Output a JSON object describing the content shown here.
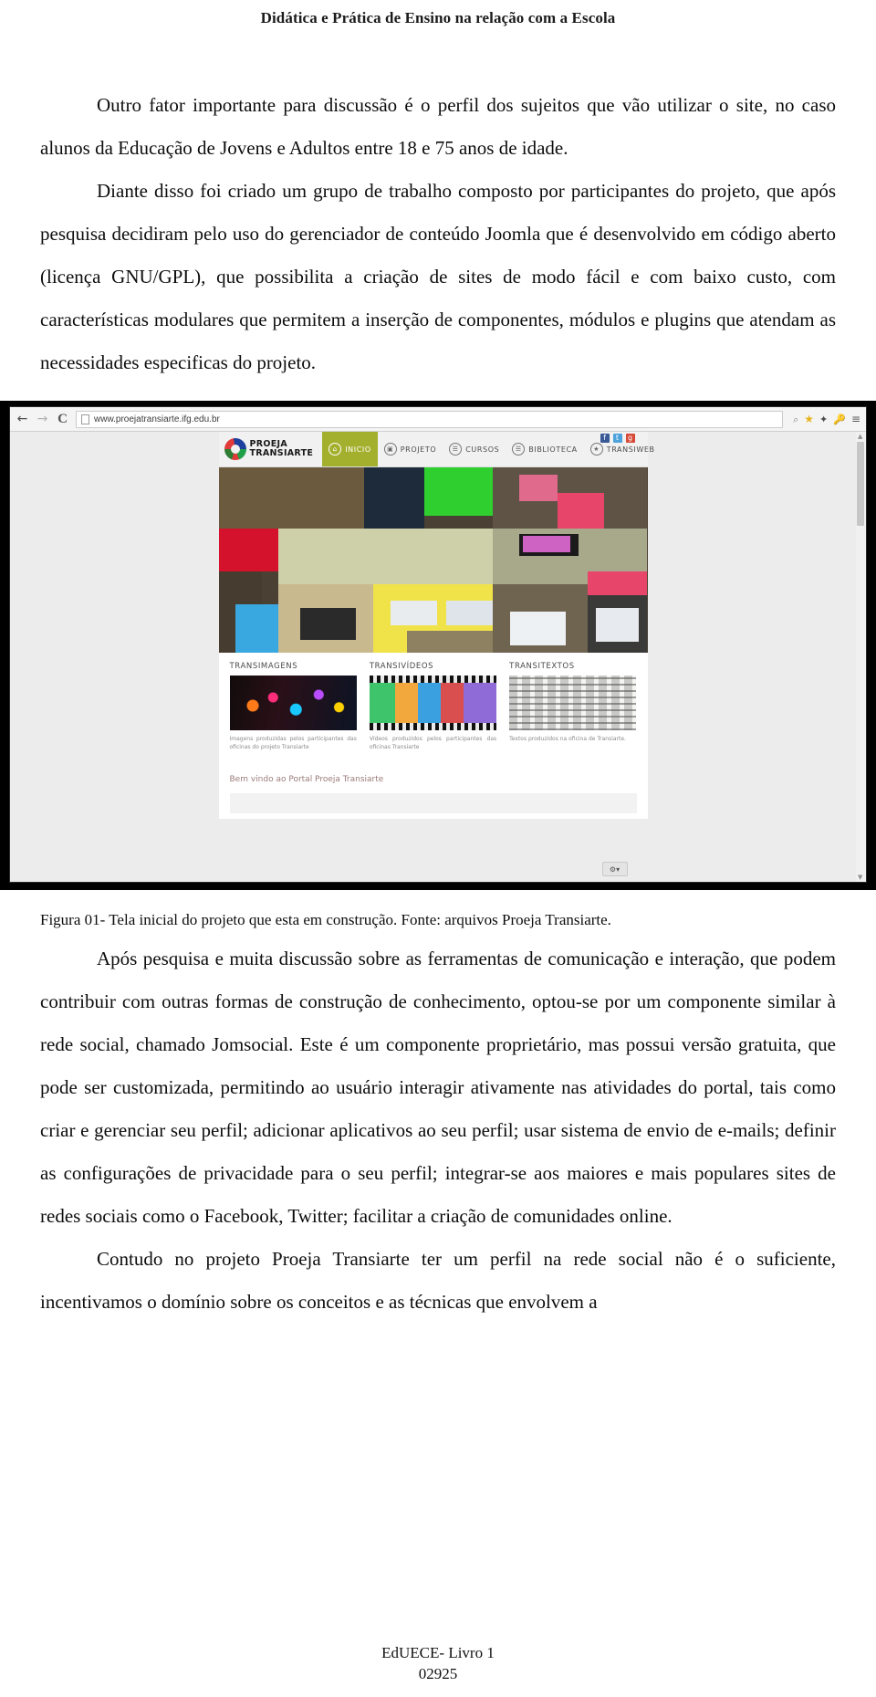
{
  "header": {
    "running_title": "Didática e Prática de Ensino na relação com a Escola"
  },
  "body": {
    "paragraph_1": "Outro fator importante para discussão é o perfil dos sujeitos que vão utilizar o site, no caso alunos da Educação de Jovens e Adultos entre 18 e 75 anos de idade.",
    "paragraph_2": "Diante disso foi criado um grupo de trabalho composto por participantes do projeto, que após pesquisa decidiram pelo uso do gerenciador de conteúdo Joomla que é desenvolvido em código aberto (licença GNU/GPL), que possibilita a criação de sites de modo fácil e com baixo custo, com características modulares que permitem a inserção de componentes, módulos e plugins que atendam as necessidades especificas do projeto.",
    "paragraph_3": "Após pesquisa e muita discussão sobre as ferramentas de comunicação e interação, que podem contribuir com outras formas de construção de conhecimento, optou-se por um componente similar à rede social, chamado Jomsocial. Este é um componente proprietário, mas possui versão gratuita, que pode ser customizada, permitindo ao usuário interagir ativamente nas atividades do portal, tais como criar e gerenciar seu perfil; adicionar aplicativos ao seu perfil; usar sistema de envio de e-mails; definir as configurações de privacidade para o seu perfil; integrar-se aos maiores e mais populares sites de redes sociais como o Facebook, Twitter; facilitar a criação de comunidades online.",
    "paragraph_4": "Contudo no projeto Proeja Transiarte ter um perfil na rede social não é o suficiente, incentivamos o domínio sobre os conceitos e as técnicas que envolvem a"
  },
  "figure": {
    "caption": "Figura 01- Tela inicial do projeto que esta em construção. Fonte: arquivos Proeja Transiarte."
  },
  "browser": {
    "back_icon": "←",
    "forward_icon": "→",
    "reload_icon": "C",
    "url": "www.proejatransiarte.ifg.edu.br",
    "toolbar_icons": {
      "search": "⌕",
      "bookmark_star": "★",
      "extension": "✦",
      "key": "🔑",
      "menu": "≡"
    }
  },
  "site": {
    "logo": {
      "line1": "PROEJA",
      "line2": "TRANSIARTE"
    },
    "nav": [
      {
        "label": "INICIO",
        "icon": "⌂",
        "active": true
      },
      {
        "label": "PROJETO",
        "icon": "▣",
        "active": false
      },
      {
        "label": "CURSOS",
        "icon": "☰",
        "active": false
      },
      {
        "label": "BIBLIOTECA",
        "icon": "☰",
        "active": false
      },
      {
        "label": "TRANSIWEB",
        "icon": "★",
        "active": false
      }
    ],
    "social": [
      {
        "name": "facebook",
        "glyph": "f"
      },
      {
        "name": "twitter",
        "glyph": "t"
      },
      {
        "name": "google-plus",
        "glyph": "g"
      }
    ],
    "columns": [
      {
        "title": "TRANSIMAGENS",
        "caption": "Imagens produzidas pelos participantes das oficinas do projeto Transiarte"
      },
      {
        "title": "TRANSIVÍDEOS",
        "caption": "Vídeos produzidos pelos participantes das oficinas Transiarte"
      },
      {
        "title": "TRANSITEXTOS",
        "caption": "Textos produzidos na oficina de Transiarte."
      }
    ],
    "welcome": "Bem vindo ao Portal Proeja Transiarte",
    "gear_label": "⚙▾",
    "colors": {
      "nav_active": "#a3b02e",
      "welcome_text": "#9c7b7b"
    }
  },
  "footer": {
    "line1": "EdUECE- Livro 1",
    "line2": "02925"
  }
}
